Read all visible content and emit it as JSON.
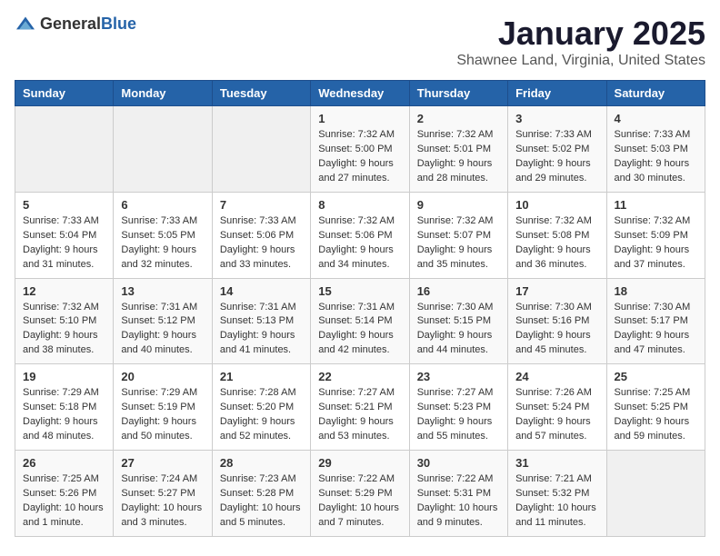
{
  "header": {
    "logo_general": "General",
    "logo_blue": "Blue",
    "title": "January 2025",
    "subtitle": "Shawnee Land, Virginia, United States"
  },
  "days_of_week": [
    "Sunday",
    "Monday",
    "Tuesday",
    "Wednesday",
    "Thursday",
    "Friday",
    "Saturday"
  ],
  "weeks": [
    [
      {
        "day": "",
        "empty": true
      },
      {
        "day": "",
        "empty": true
      },
      {
        "day": "",
        "empty": true
      },
      {
        "day": "1",
        "sunrise": "7:32 AM",
        "sunset": "5:00 PM",
        "daylight": "Daylight: 9 hours and 27 minutes."
      },
      {
        "day": "2",
        "sunrise": "7:32 AM",
        "sunset": "5:01 PM",
        "daylight": "Daylight: 9 hours and 28 minutes."
      },
      {
        "day": "3",
        "sunrise": "7:33 AM",
        "sunset": "5:02 PM",
        "daylight": "Daylight: 9 hours and 29 minutes."
      },
      {
        "day": "4",
        "sunrise": "7:33 AM",
        "sunset": "5:03 PM",
        "daylight": "Daylight: 9 hours and 30 minutes."
      }
    ],
    [
      {
        "day": "5",
        "sunrise": "7:33 AM",
        "sunset": "5:04 PM",
        "daylight": "Daylight: 9 hours and 31 minutes."
      },
      {
        "day": "6",
        "sunrise": "7:33 AM",
        "sunset": "5:05 PM",
        "daylight": "Daylight: 9 hours and 32 minutes."
      },
      {
        "day": "7",
        "sunrise": "7:33 AM",
        "sunset": "5:06 PM",
        "daylight": "Daylight: 9 hours and 33 minutes."
      },
      {
        "day": "8",
        "sunrise": "7:32 AM",
        "sunset": "5:06 PM",
        "daylight": "Daylight: 9 hours and 34 minutes."
      },
      {
        "day": "9",
        "sunrise": "7:32 AM",
        "sunset": "5:07 PM",
        "daylight": "Daylight: 9 hours and 35 minutes."
      },
      {
        "day": "10",
        "sunrise": "7:32 AM",
        "sunset": "5:08 PM",
        "daylight": "Daylight: 9 hours and 36 minutes."
      },
      {
        "day": "11",
        "sunrise": "7:32 AM",
        "sunset": "5:09 PM",
        "daylight": "Daylight: 9 hours and 37 minutes."
      }
    ],
    [
      {
        "day": "12",
        "sunrise": "7:32 AM",
        "sunset": "5:10 PM",
        "daylight": "Daylight: 9 hours and 38 minutes."
      },
      {
        "day": "13",
        "sunrise": "7:31 AM",
        "sunset": "5:12 PM",
        "daylight": "Daylight: 9 hours and 40 minutes."
      },
      {
        "day": "14",
        "sunrise": "7:31 AM",
        "sunset": "5:13 PM",
        "daylight": "Daylight: 9 hours and 41 minutes."
      },
      {
        "day": "15",
        "sunrise": "7:31 AM",
        "sunset": "5:14 PM",
        "daylight": "Daylight: 9 hours and 42 minutes."
      },
      {
        "day": "16",
        "sunrise": "7:30 AM",
        "sunset": "5:15 PM",
        "daylight": "Daylight: 9 hours and 44 minutes."
      },
      {
        "day": "17",
        "sunrise": "7:30 AM",
        "sunset": "5:16 PM",
        "daylight": "Daylight: 9 hours and 45 minutes."
      },
      {
        "day": "18",
        "sunrise": "7:30 AM",
        "sunset": "5:17 PM",
        "daylight": "Daylight: 9 hours and 47 minutes."
      }
    ],
    [
      {
        "day": "19",
        "sunrise": "7:29 AM",
        "sunset": "5:18 PM",
        "daylight": "Daylight: 9 hours and 48 minutes."
      },
      {
        "day": "20",
        "sunrise": "7:29 AM",
        "sunset": "5:19 PM",
        "daylight": "Daylight: 9 hours and 50 minutes."
      },
      {
        "day": "21",
        "sunrise": "7:28 AM",
        "sunset": "5:20 PM",
        "daylight": "Daylight: 9 hours and 52 minutes."
      },
      {
        "day": "22",
        "sunrise": "7:27 AM",
        "sunset": "5:21 PM",
        "daylight": "Daylight: 9 hours and 53 minutes."
      },
      {
        "day": "23",
        "sunrise": "7:27 AM",
        "sunset": "5:23 PM",
        "daylight": "Daylight: 9 hours and 55 minutes."
      },
      {
        "day": "24",
        "sunrise": "7:26 AM",
        "sunset": "5:24 PM",
        "daylight": "Daylight: 9 hours and 57 minutes."
      },
      {
        "day": "25",
        "sunrise": "7:25 AM",
        "sunset": "5:25 PM",
        "daylight": "Daylight: 9 hours and 59 minutes."
      }
    ],
    [
      {
        "day": "26",
        "sunrise": "7:25 AM",
        "sunset": "5:26 PM",
        "daylight": "Daylight: 10 hours and 1 minute."
      },
      {
        "day": "27",
        "sunrise": "7:24 AM",
        "sunset": "5:27 PM",
        "daylight": "Daylight: 10 hours and 3 minutes."
      },
      {
        "day": "28",
        "sunrise": "7:23 AM",
        "sunset": "5:28 PM",
        "daylight": "Daylight: 10 hours and 5 minutes."
      },
      {
        "day": "29",
        "sunrise": "7:22 AM",
        "sunset": "5:29 PM",
        "daylight": "Daylight: 10 hours and 7 minutes."
      },
      {
        "day": "30",
        "sunrise": "7:22 AM",
        "sunset": "5:31 PM",
        "daylight": "Daylight: 10 hours and 9 minutes."
      },
      {
        "day": "31",
        "sunrise": "7:21 AM",
        "sunset": "5:32 PM",
        "daylight": "Daylight: 10 hours and 11 minutes."
      },
      {
        "day": "",
        "empty": true
      }
    ]
  ]
}
